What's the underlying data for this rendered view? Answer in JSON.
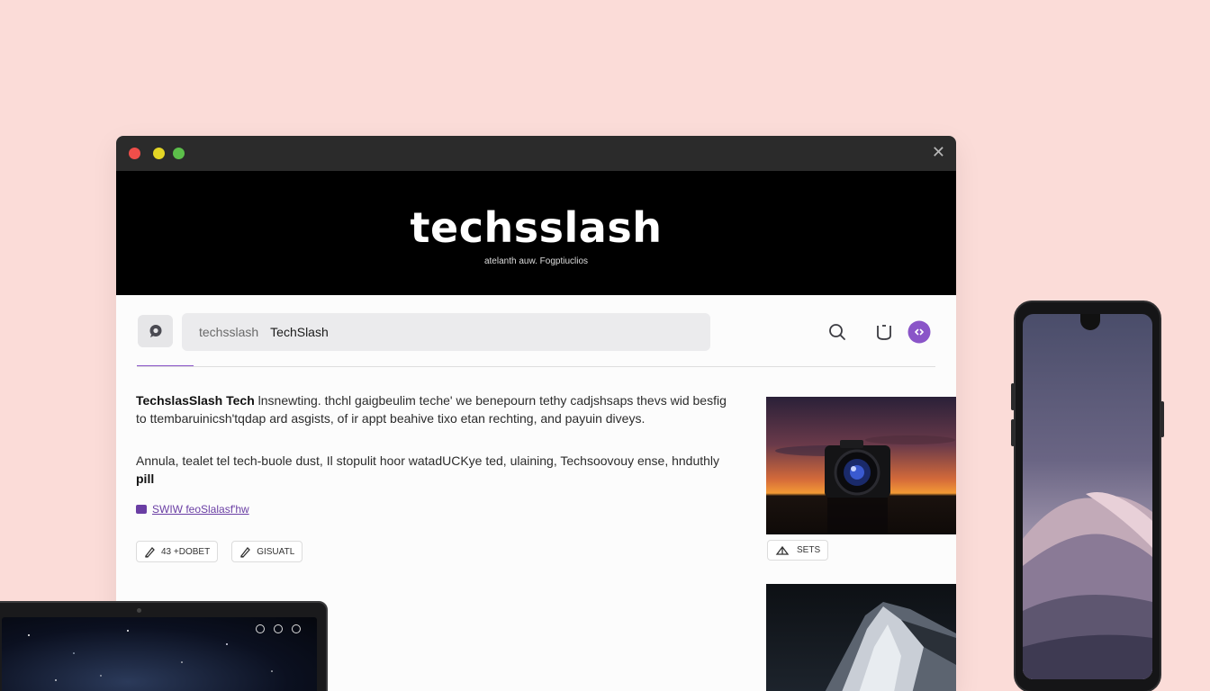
{
  "window": {
    "close_symbol": "✕"
  },
  "hero": {
    "title": "techsslash",
    "subtitle": "atelanth auw. Fogptiuclios"
  },
  "toolbar": {
    "logo_icon": "chat-bubble-icon",
    "search_placeholder": "techsslash",
    "search_value": "TechSlash",
    "icons": [
      "search-icon",
      "bookmark-icon",
      "profile-icon"
    ],
    "accent_color": "#8a55c8"
  },
  "article": {
    "para1_bold": "TechslasSlash Tech",
    "para1_rest": " lnsnewting. thchl gaigbeulim teche' we benepourn tethy cadjshsaps thevs wid besfig to ttembaruinicsh'tqdap ard asgists, of ir appt beahive tixo etan rechting, and payuin diveys.",
    "para2_main": "Annula, tealet tel tech-buole dust, Il stopulit hoor watadUCKye ted, ulaining, Techsoovouy ense, hnduthly",
    "para2_bold": "pill",
    "link_text": "SWIW feoSlalasf'hw",
    "tags": [
      "43 +DOBET",
      "GISUATL"
    ]
  },
  "thumbs": {
    "sets_label": "SETS"
  }
}
